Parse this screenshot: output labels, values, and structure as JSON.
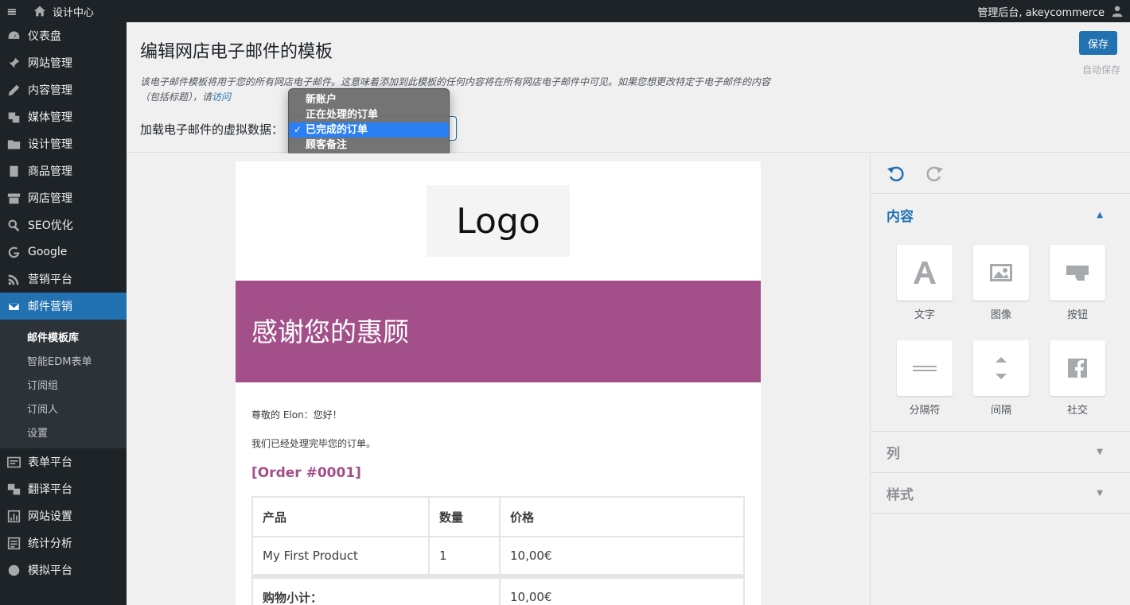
{
  "adminbar": {
    "menu_icon": "hamburger-icon",
    "site_title": "设计中心",
    "user_greeting": "管理后台, akeycommerce"
  },
  "sidebar": {
    "items": [
      {
        "label": "仪表盘",
        "icon": "dashboard-icon"
      },
      {
        "label": "网站管理",
        "icon": "pin-icon"
      },
      {
        "label": "内容管理",
        "icon": "edit-icon"
      },
      {
        "label": "媒体管理",
        "icon": "media-icon"
      },
      {
        "label": "设计管理",
        "icon": "folder-icon"
      },
      {
        "label": "商品管理",
        "icon": "book-icon"
      },
      {
        "label": "网店管理",
        "icon": "store-icon"
      },
      {
        "label": "SEO优化",
        "icon": "search-icon"
      },
      {
        "label": "Google",
        "icon": "google-icon"
      },
      {
        "label": "营销平台",
        "icon": "rss-icon"
      },
      {
        "label": "邮件营销",
        "icon": "email-icon"
      }
    ],
    "submenu": [
      "邮件模板库",
      "智能EDM表单",
      "订阅组",
      "订阅人",
      "设置"
    ],
    "items_after": [
      {
        "label": "表单平台",
        "icon": "form-icon"
      },
      {
        "label": "翻译平台",
        "icon": "translate-icon"
      },
      {
        "label": "网站设置",
        "icon": "settings-icon"
      },
      {
        "label": "统计分析",
        "icon": "stats-icon"
      },
      {
        "label": "模拟平台",
        "icon": "globe-icon"
      }
    ]
  },
  "header": {
    "title": "编辑网店电子邮件的模板",
    "description_prefix": "该电子邮件模板将用于您的所有网店电子邮件。这意味着添加到此模板的任何内容将在所有网店电子邮件中可见。如果您想更改特定于电子邮件的内容（包括标题），请",
    "description_link": "访问",
    "dummy_label": "加载电子邮件的虚拟数据：",
    "save_label": "保存",
    "autosave_label": "自动保存"
  },
  "dropdown": {
    "options": [
      "新账户",
      "正在处理的订单",
      "已完成的订单",
      "顾客备注"
    ],
    "selected": "已完成的订单",
    "check": "✓"
  },
  "email": {
    "logo_text": "Logo",
    "banner_title": "感谢您的惠顾",
    "banner_color": "#a3508a",
    "greeting": "尊敬的 Elon：您好！",
    "processed_text": "我们已经处理完毕您的订单。",
    "order_number": "[Order #0001]",
    "table": {
      "headers": [
        "产品",
        "数量",
        "价格"
      ],
      "rows": [
        [
          "My First Product",
          "1",
          "10,00€"
        ]
      ],
      "subtotal_label": "购物小计：",
      "subtotal_value": "10,00€"
    }
  },
  "panel": {
    "undo_icon": "undo-icon",
    "redo_icon": "redo-icon",
    "content_title": "内容",
    "blocks": [
      {
        "label": "文字",
        "icon": "text-icon"
      },
      {
        "label": "图像",
        "icon": "image-icon"
      },
      {
        "label": "按钮",
        "icon": "button-icon"
      },
      {
        "label": "分隔符",
        "icon": "divider-icon"
      },
      {
        "label": "间隔",
        "icon": "spacer-icon"
      },
      {
        "label": "社交",
        "icon": "facebook-icon"
      }
    ],
    "columns_title": "列",
    "styles_title": "样式"
  },
  "colors": {
    "accent": "#2271b1",
    "sidebar_bg": "#1d2327",
    "brand_purple": "#a3508a"
  }
}
